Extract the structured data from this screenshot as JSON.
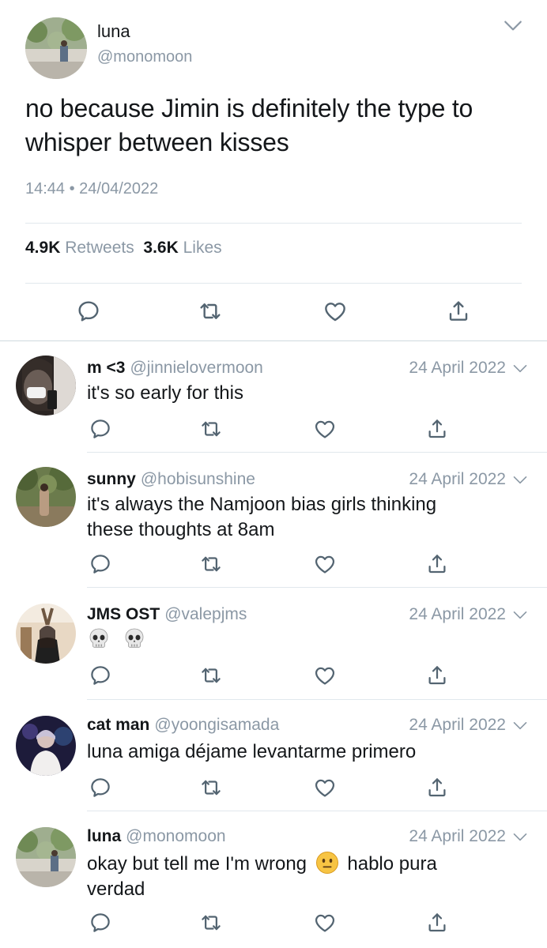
{
  "main_tweet": {
    "name": "luna",
    "handle": "@monomoon",
    "text": "no because Jimin is definitely the type to whisper between kisses",
    "timestamp": "14:44 • 24/04/2022",
    "retweets_count": "4.9K",
    "retweets_label": "Retweets",
    "likes_count": "3.6K",
    "likes_label": "Likes"
  },
  "replies": [
    {
      "name": "m <3",
      "handle": "@jinnielovermoon",
      "date": "24 April 2022",
      "text": "it's so early for this"
    },
    {
      "name": "sunny",
      "handle": "@hobisunshine",
      "date": "24 April 2022",
      "text": "it's always the Namjoon bias girls thinking these thoughts at 8am"
    },
    {
      "name": "JMS OST",
      "handle": "@valepjms",
      "date": "24 April 2022",
      "text": "💀💀"
    },
    {
      "name": "cat man",
      "handle": "@yoongisamada",
      "date": "24 April 2022",
      "text": "luna amiga déjame levantarme primero"
    },
    {
      "name": "luna",
      "handle": "@monomoon",
      "date": "24 April 2022",
      "text_part1": "okay but tell me I'm wrong",
      "text_part2": "hablo pura verdad"
    }
  ],
  "icons": [
    "reply-icon",
    "retweet-icon",
    "like-icon",
    "share-icon",
    "chevron-down-icon",
    "skull-emoji",
    "neutral-face-emoji"
  ],
  "colors": {
    "text": "#14171a",
    "secondary": "#8b98a5",
    "icon": "#536471",
    "separator": "#e1e8ed"
  }
}
